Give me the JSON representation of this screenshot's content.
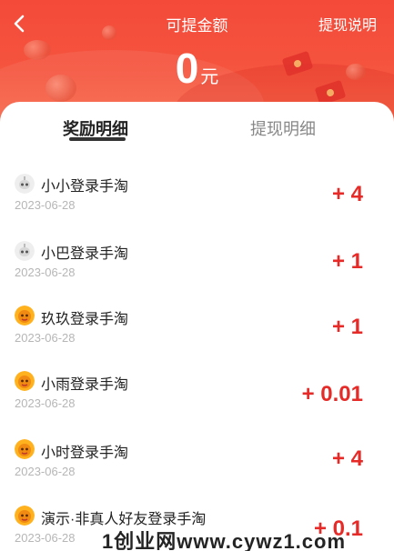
{
  "header": {
    "title": "可提金额",
    "explain_link": "提现说明",
    "amount": "0",
    "amount_unit": "元"
  },
  "tabs": [
    {
      "label": "奖励明细",
      "active": true
    },
    {
      "label": "提现明细",
      "active": false
    }
  ],
  "records": [
    {
      "name": "小小登录手淘",
      "date": "2023-06-28",
      "amount": "+ 4",
      "avatar": "robot-avatar"
    },
    {
      "name": "小巴登录手淘",
      "date": "2023-06-28",
      "amount": "+ 1",
      "avatar": "robot-avatar"
    },
    {
      "name": "玖玖登录手淘",
      "date": "2023-06-28",
      "amount": "+ 1",
      "avatar": "orange-creature-avatar"
    },
    {
      "name": "小雨登录手淘",
      "date": "2023-06-28",
      "amount": "+ 0.01",
      "avatar": "orange-creature-avatar"
    },
    {
      "name": "小时登录手淘",
      "date": "2023-06-28",
      "amount": "+ 4",
      "avatar": "orange-creature-avatar"
    },
    {
      "name": "演示·非真人好友登录手淘",
      "date": "2023-06-28",
      "amount": "+ 0.1",
      "avatar": "orange-creature-avatar"
    }
  ],
  "watermark": "1创业网www.cywz1.com",
  "colors": {
    "header_red": "#f5543e",
    "amount_red": "#e52a27",
    "date_gray": "#b6b6b6"
  }
}
